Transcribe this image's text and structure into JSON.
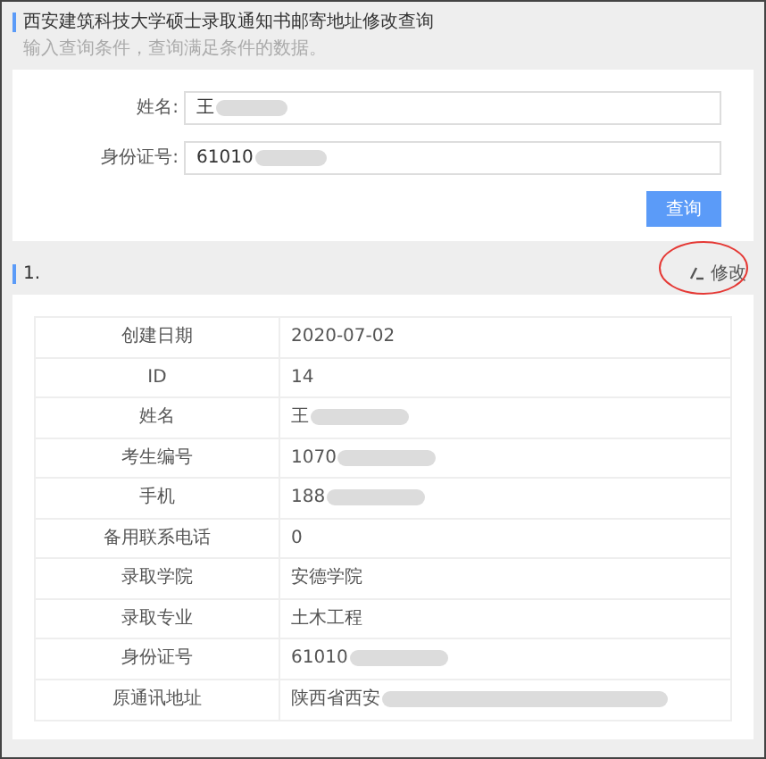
{
  "header": {
    "title": "西安建筑科技大学硕士录取通知书邮寄地址修改查询",
    "subtitle": "输入查询条件，查询满足条件的数据。"
  },
  "form": {
    "fields": [
      {
        "label": "姓名:",
        "value": "王",
        "redacted": true
      },
      {
        "label": "身份证号:",
        "value": "61010",
        "redacted": true
      }
    ],
    "submit": "查询"
  },
  "result": {
    "title": "1.",
    "edit": {
      "label": "修改",
      "highlighted": true
    },
    "rows": [
      {
        "label": "创建日期",
        "value": "2020-07-02",
        "redacted": false
      },
      {
        "label": "ID",
        "value": "14",
        "redacted": false
      },
      {
        "label": "姓名",
        "value": "王",
        "redacted": true
      },
      {
        "label": "考生编号",
        "value": "1070",
        "redacted": true
      },
      {
        "label": "手机",
        "value": "188",
        "redacted": true
      },
      {
        "label": "备用联系电话",
        "value": "0",
        "redacted": false
      },
      {
        "label": "录取学院",
        "value": "安德学院",
        "redacted": false
      },
      {
        "label": "录取专业",
        "value": "土木工程",
        "redacted": false
      },
      {
        "label": "身份证号",
        "value": "61010",
        "redacted": true
      },
      {
        "label": "原通讯地址",
        "value": "陕西省西安",
        "redacted": true
      }
    ]
  }
}
